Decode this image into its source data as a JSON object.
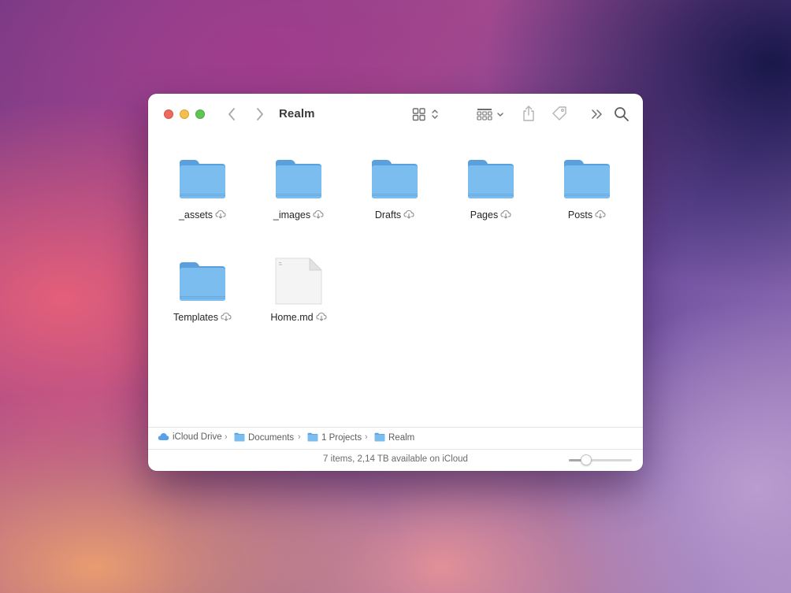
{
  "window": {
    "title": "Realm"
  },
  "toolbar": {
    "icons": [
      "back-chevron-icon",
      "forward-chevron-icon",
      "icon-view-grid-icon",
      "group-by-icon",
      "share-icon",
      "tag-icon",
      "more-toolbar-items-icon",
      "search-icon"
    ]
  },
  "items": [
    {
      "name": "_assets",
      "kind": "folder",
      "sync": "cloud"
    },
    {
      "name": "_images",
      "kind": "folder",
      "sync": "cloud"
    },
    {
      "name": "Drafts",
      "kind": "folder",
      "sync": "cloud"
    },
    {
      "name": "Pages",
      "kind": "folder",
      "sync": "cloud"
    },
    {
      "name": "Posts",
      "kind": "folder",
      "sync": "cloud"
    },
    {
      "name": "Templates",
      "kind": "folder",
      "sync": "cloud"
    },
    {
      "name": "Home.md",
      "kind": "document",
      "sync": "cloud"
    }
  ],
  "pathbar": {
    "segments": [
      "iCloud Drive",
      "Documents",
      "1 Projects",
      "Realm"
    ]
  },
  "status": {
    "text": "7 items, 2,14 TB available on iCloud",
    "icon_size_fraction": 0.27
  },
  "colors": {
    "folder": "#6fb3ec",
    "folder_tab": "#5aa0dc",
    "close": "#ed6a5e",
    "minimize": "#f5bf4f",
    "zoom": "#61c554"
  }
}
